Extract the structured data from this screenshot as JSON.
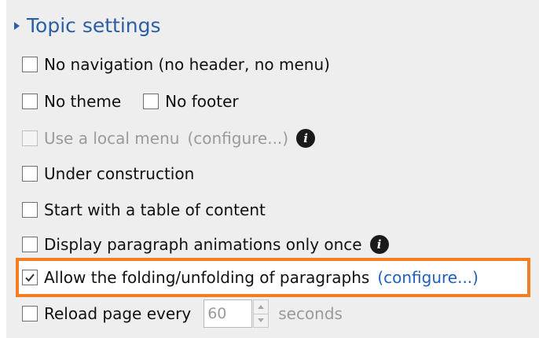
{
  "section": {
    "title": "Topic settings",
    "icon": "expand-triangle-icon"
  },
  "options": {
    "no_navigation": {
      "label": "No navigation (no header, no menu)",
      "checked": false
    },
    "no_theme": {
      "label": "No theme",
      "checked": false
    },
    "no_footer": {
      "label": "No footer",
      "checked": false
    },
    "local_menu": {
      "label": "Use a local menu",
      "link": "(configure...)",
      "checked": false,
      "enabled": false,
      "icon": "info-icon"
    },
    "under_construction": {
      "label": "Under construction",
      "checked": false
    },
    "table_of_content": {
      "label": "Start with a table of content",
      "checked": false
    },
    "animations_once": {
      "label": "Display paragraph animations only once",
      "checked": false,
      "icon": "info-icon"
    },
    "folding": {
      "label": "Allow the folding/unfolding of paragraphs",
      "link": "(configure...)",
      "checked": true
    },
    "reload": {
      "label": "Reload page every",
      "value": "60",
      "unit": "seconds",
      "checked": false
    }
  },
  "colors": {
    "title": "#2a5ea8",
    "link": "#2060c0",
    "highlight": "#f47d20",
    "disabled": "#9a9a9a",
    "background": "#eeeeee"
  }
}
